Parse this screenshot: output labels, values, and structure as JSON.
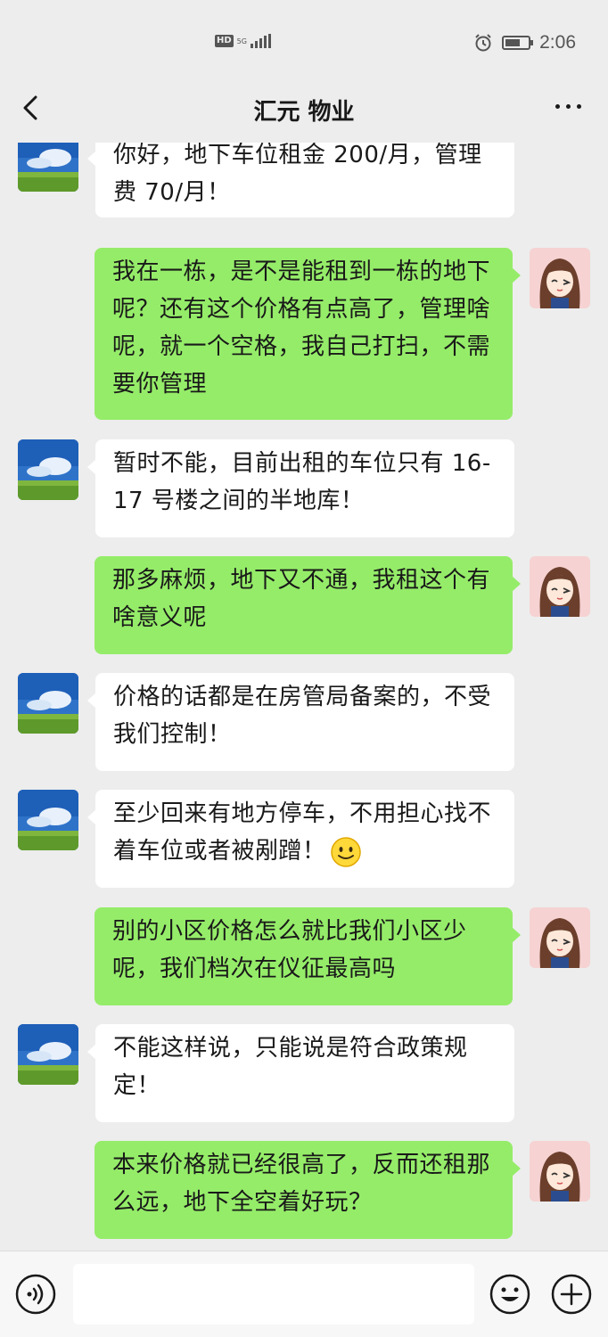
{
  "status": {
    "time": "2:06",
    "hd": "HD",
    "network": "5G"
  },
  "nav": {
    "title": "汇元 物业"
  },
  "colors": {
    "background": "#ededed",
    "bubble_self": "#95ec69",
    "bubble_other": "#ffffff"
  },
  "messages": [
    {
      "sender": "other",
      "text": "你好，地下车位租金 200/月，管理费 70/月！"
    },
    {
      "sender": "self",
      "text": "我在一栋，是不是能租到一栋的地下呢？还有这个价格有点高了，管理啥呢，就一个空格，我自己打扫，不需要你管理"
    },
    {
      "sender": "other",
      "text": "暂时不能，目前出租的车位只有 16-17 号楼之间的半地库！"
    },
    {
      "sender": "self",
      "text": "那多麻烦，地下又不通，我租这个有啥意义呢"
    },
    {
      "sender": "other",
      "text": "价格的话都是在房管局备案的，不受我们控制！"
    },
    {
      "sender": "other",
      "text": "至少回来有地方停车，不用担心找不着车位或者被剐蹭！",
      "emoji": "smile-emoji"
    },
    {
      "sender": "self",
      "text": "别的小区价格怎么就比我们小区少呢，我们档次在仪征最高吗"
    },
    {
      "sender": "other",
      "text": "不能这样说，只能说是符合政策规定！"
    },
    {
      "sender": "self",
      "text": "本来价格就已经很高了，反而还租那么远，地下全空着好玩？"
    }
  ],
  "input": {
    "placeholder": ""
  }
}
